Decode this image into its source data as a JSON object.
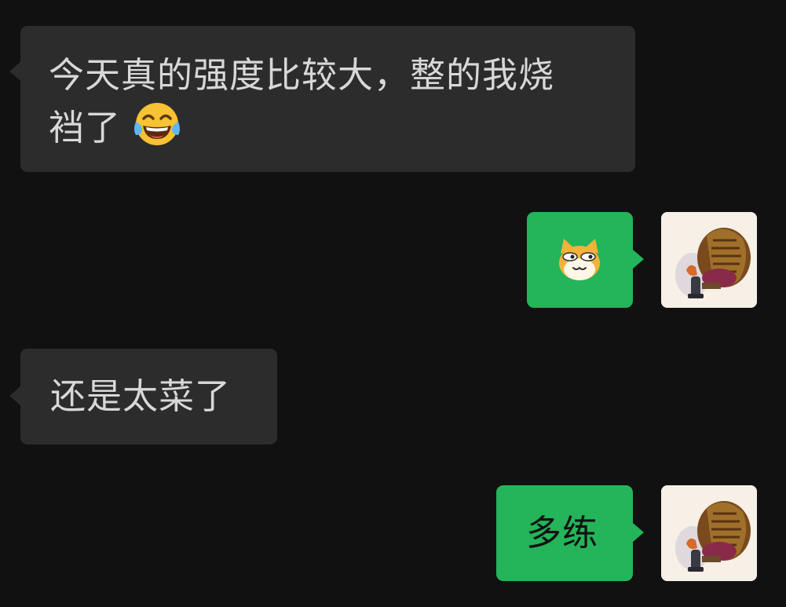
{
  "messages": [
    {
      "side": "incoming",
      "line1": "今天真的强度比较大，整的我烧",
      "line2": "裆了",
      "emoji": "face-with-tears-of-joy-icon"
    },
    {
      "side": "outgoing",
      "emoji": "smirking-cat-sticker-icon"
    },
    {
      "side": "incoming",
      "text": "还是太菜了"
    },
    {
      "side": "outgoing",
      "text": "多练"
    }
  ],
  "colors": {
    "background": "#111111",
    "incoming_bubble": "#2c2c2c",
    "outgoing_bubble": "#24b45a",
    "incoming_text": "#d8d8d8",
    "outgoing_text": "#111111"
  }
}
